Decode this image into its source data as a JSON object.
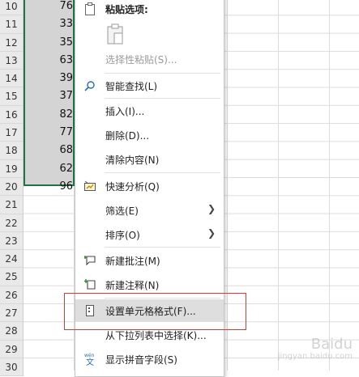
{
  "row_numbers": [
    "10",
    "11",
    "12",
    "13",
    "14",
    "15",
    "16",
    "17",
    "18",
    "19",
    "20",
    "21",
    "22",
    "23",
    "24",
    "25",
    "26",
    "27",
    "28",
    "29",
    "30"
  ],
  "cell_values": [
    "76",
    "33",
    "35",
    "63",
    "39",
    "37",
    "82",
    "77",
    "68",
    "62",
    "96"
  ],
  "context_menu": {
    "paste_options_label": "粘贴选项:",
    "paste_special_label": "选择性粘贴(S)...",
    "smart_lookup_label": "智能查找(L)",
    "insert_label": "插入(I)...",
    "delete_label": "删除(D)...",
    "clear_contents_label": "清除内容(N)",
    "quick_analysis_label": "快速分析(Q)",
    "filter_label": "筛选(E)",
    "sort_label": "排序(O)",
    "new_comment_label": "新建批注(M)",
    "new_note_label": "新建注释(N)",
    "format_cells_label": "设置单元格格式(F)...",
    "pick_from_list_label": "从下拉列表中选择(K)...",
    "phonetic_label": "显示拼音字段(S)"
  },
  "icons": {
    "paste": "clipboard-icon",
    "smart_lookup": "search-icon",
    "quick_analysis": "quick-analysis-icon",
    "new_comment": "comment-icon",
    "new_note": "note-icon",
    "format_cells": "format-cells-icon",
    "phonetic": "phonetic-icon"
  },
  "colors": {
    "selection_border": "#217346",
    "highlight_box": "#d9383a",
    "hover_bg": "#dedede"
  },
  "watermark": {
    "text": "Baidu",
    "sub": "jingyan.baidu.com"
  }
}
